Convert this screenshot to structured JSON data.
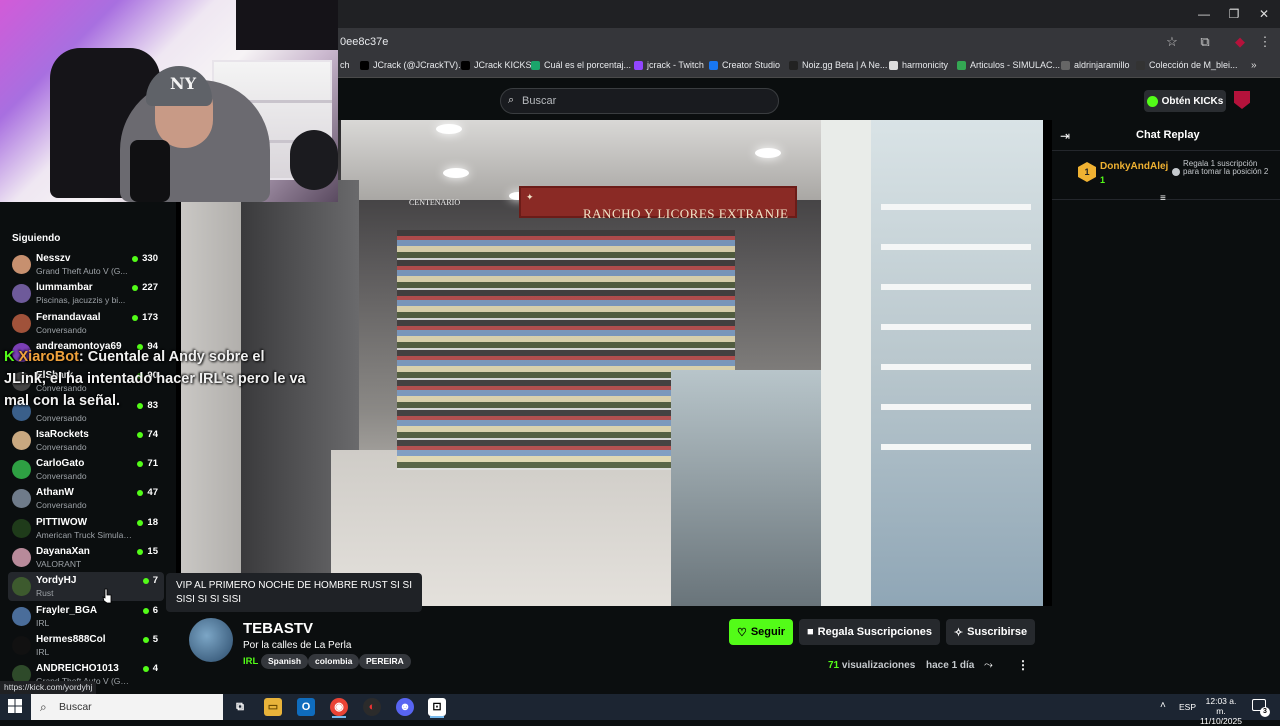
{
  "browser": {
    "url": "0ee8c37e",
    "window_buttons": {
      "minimize": "—",
      "maximize": "❐",
      "close": "✕"
    },
    "bookmarks": [
      {
        "label": "ch",
        "color": "#000000"
      },
      {
        "label": "JCrack (@JCrackTV)...",
        "color": "#000000"
      },
      {
        "label": "JCrack KICKS",
        "color": "#000000"
      },
      {
        "label": "Cuál es el porcentaj...",
        "color": "#1ba56b"
      },
      {
        "label": "jcrack - Twitch",
        "color": "#9146ff"
      },
      {
        "label": "Creator Studio",
        "color": "#1877f2"
      },
      {
        "label": "Noiz.gg Beta | A Ne...",
        "color": "#222222"
      },
      {
        "label": "harmonicity",
        "color": "#dddddd"
      },
      {
        "label": "Articulos - SIMULAC...",
        "color": "#34a853"
      },
      {
        "label": "aldrinjaramillo",
        "color": "#666666"
      },
      {
        "label": "Colección de M_blei...",
        "color": "#333333"
      }
    ]
  },
  "header": {
    "search_placeholder": "Buscar",
    "kicks_button": "Obtén KICKs"
  },
  "sidebar": {
    "title": "Siguiendo",
    "channels": [
      {
        "name": "Nesszv",
        "category": "Grand Theft Auto V (G...",
        "viewers": "330",
        "avatar": "#c7906f"
      },
      {
        "name": "lummambar",
        "category": "Piscinas, jacuzzis y bi...",
        "viewers": "227",
        "avatar": "#6e5a9a"
      },
      {
        "name": "Fernandavaal",
        "category": "Conversando",
        "viewers": "173",
        "avatar": "#a0523a"
      },
      {
        "name": "andreamontoya69",
        "category": "",
        "viewers": "94",
        "avatar": "#7a3fb5"
      },
      {
        "name": "ElShark",
        "category": "Conversando",
        "viewers": "90",
        "avatar": "#444444"
      },
      {
        "name": "",
        "category": "Conversando",
        "viewers": "83",
        "avatar": "#3a5f8a"
      },
      {
        "name": "IsaRockets",
        "category": "Conversando",
        "viewers": "74",
        "avatar": "#c9a880"
      },
      {
        "name": "CarloGato",
        "category": "Conversando",
        "viewers": "71",
        "avatar": "#2ea043"
      },
      {
        "name": "AthanW",
        "category": "Conversando",
        "viewers": "47",
        "avatar": "#6f7b8a"
      },
      {
        "name": "PITTIWOW",
        "category": "American Truck Simulator",
        "viewers": "18",
        "avatar": "#1f3b1a"
      },
      {
        "name": "DayanaXan",
        "category": "VALORANT",
        "viewers": "15",
        "avatar": "#b88a9a"
      },
      {
        "name": "YordyHJ",
        "category": "Rust",
        "viewers": "7",
        "avatar": "#3d5a2e"
      },
      {
        "name": "Frayler_BGA",
        "category": "IRL",
        "viewers": "6",
        "avatar": "#4a6d9a"
      },
      {
        "name": "Hermes888Col",
        "category": "IRL",
        "viewers": "5",
        "avatar": "#111111"
      },
      {
        "name": "ANDREICHO1013",
        "category": "Grand Theft Auto V (GTA)",
        "viewers": "4",
        "avatar": "#2e4a2a"
      }
    ]
  },
  "overlay_chat": {
    "bot_name": "XiaroBot",
    "line1_rest": ": Cuentale al Andy sobre el",
    "line2": "JLink, el ha intentado hacer IRL's pero le va",
    "line3": "mal con la señal."
  },
  "webcam": {
    "cap_logo": "NY"
  },
  "video": {
    "shop_sign": "RANCHO Y LICORES EXTRANJE",
    "sign_small": "CENTENARIO"
  },
  "tooltip": {
    "text": "VIP AL PRIMERO NOCHE DE HOMBRE RUST SI SI SISI SI SI SISI"
  },
  "stream": {
    "streamer": "TEBASTV",
    "title": "Por la calles de La Perla",
    "category": "IRL",
    "tags": [
      "Spanish",
      "colombia",
      "PEREIRA"
    ],
    "follow": "Seguir",
    "gift": "Regala Suscripciones",
    "subscribe": "Suscribirse",
    "views_count": "71",
    "views_label": "visualizaciones",
    "time_ago": "hace 1 día"
  },
  "chat": {
    "title": "Chat Replay",
    "top_donor": {
      "rank": "1",
      "name": "DonkyAndAlej",
      "count": "1"
    },
    "gift_note": "Regala 1 suscripción para tomar la posición 2"
  },
  "status_url": "https://kick.com/yordyhj",
  "taskbar": {
    "search": "Buscar",
    "lang": "ESP",
    "time": "12:03 a. m.",
    "date": "11/10/2025",
    "notif_count": "3"
  },
  "colors": {
    "kick_green": "#53fc18",
    "gold": "#f0b232",
    "background": "#0b0e0f"
  }
}
